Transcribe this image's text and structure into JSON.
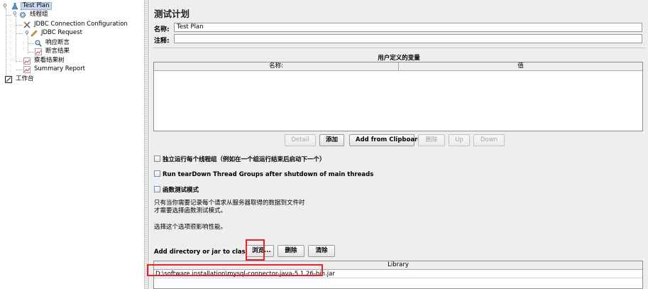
{
  "tree": {
    "items": [
      {
        "label": "Test Plan",
        "icon": "flask-icon"
      },
      {
        "label": "线程组",
        "icon": "gear-icon"
      },
      {
        "label": "JDBC Connection Configuration",
        "icon": "wrench-icon"
      },
      {
        "label": "JDBC Request",
        "icon": "pencil-icon"
      },
      {
        "label": "响应断言",
        "icon": "magnifier-icon"
      },
      {
        "label": "断言结果",
        "icon": "chart-icon"
      },
      {
        "label": "察看结果树",
        "icon": "chart-icon"
      },
      {
        "label": "Summary Report",
        "icon": "chart-icon"
      },
      {
        "label": "工作台",
        "icon": "workbench-icon"
      }
    ]
  },
  "plan": {
    "title": "测试计划",
    "name_label": "名称:",
    "name_value": "Test Plan",
    "comment_label": "注释:",
    "comment_value": ""
  },
  "user_vars": {
    "title": "用户定义的变量",
    "columns": [
      "名称:",
      "值"
    ]
  },
  "var_buttons": {
    "detail": "Detail",
    "add": "添加",
    "add_clipboard": "Add from Clipboard",
    "delete": "删除",
    "up": "Up",
    "down": "Down"
  },
  "options": {
    "serialize": "独立运行每个线程组（例如在一个组运行结束后启动下一个）",
    "teardown": "Run tearDown Thread Groups after shutdown of main threads",
    "functional": "函数测试模式",
    "info_line1": "只有当你需要记录每个请求从服务器取得的数据到文件时",
    "info_line2": "才需要选择函数测试模式。",
    "info_line3": "选择这个选项很影响性能。"
  },
  "classpath": {
    "label": "Add directory or jar to classpath",
    "browse": "浏览...",
    "delete": "删除",
    "clear": "清除",
    "column": "Library",
    "rows": [
      "D:\\software installation\\mysql-connector-java-5.1.26-bin.jar"
    ]
  },
  "colors": {
    "highlight": "#e8242a",
    "selection": "#c7d7ef"
  }
}
